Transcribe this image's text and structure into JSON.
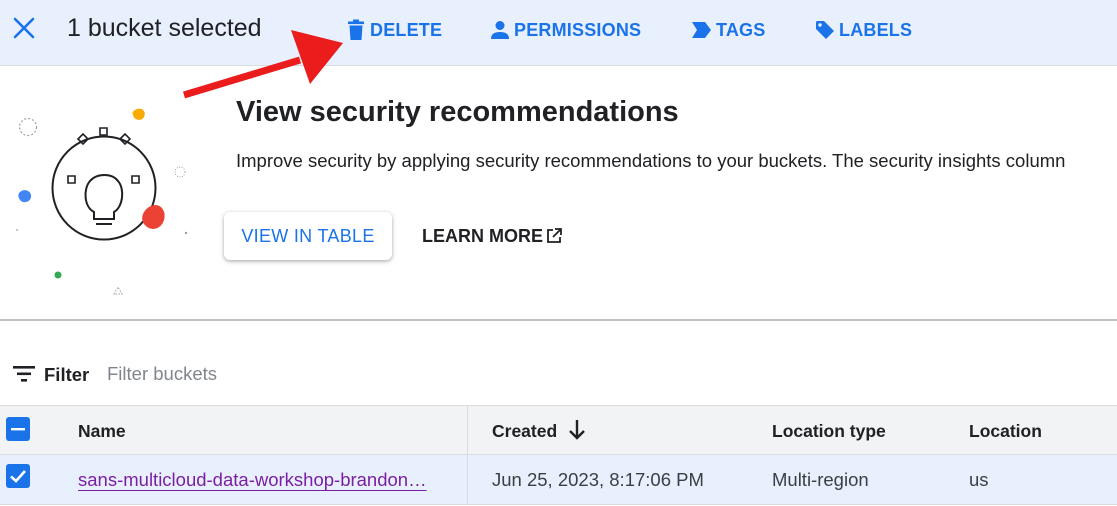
{
  "selection_bar": {
    "title": "1 bucket selected",
    "actions": [
      {
        "label": "DELETE",
        "icon": "trash-icon"
      },
      {
        "label": "PERMISSIONS",
        "icon": "person-icon"
      },
      {
        "label": "TAGS",
        "icon": "tag-arrow-icon"
      },
      {
        "label": "LABELS",
        "icon": "label-icon"
      }
    ]
  },
  "recommendations": {
    "title": "View security recommendations",
    "description": "Improve security by applying security recommendations to your buckets. The security insights column",
    "view_button": "VIEW IN TABLE",
    "learn_more": "LEARN MORE"
  },
  "filter": {
    "label": "Filter",
    "placeholder": "Filter buckets"
  },
  "table": {
    "columns": [
      "Name",
      "Created",
      "Location type",
      "Location"
    ],
    "sort_column": "Created",
    "sort_direction": "descending",
    "rows": [
      {
        "selected": true,
        "name": "sans-multicloud-data-workshop-brandon…",
        "created": "Jun 25, 2023, 8:17:06 PM",
        "location_type": "Multi-region",
        "location": "us"
      }
    ]
  },
  "colors": {
    "accent": "#1a73e8",
    "selection_bg": "#e8f0fe",
    "annotation_arrow": "#ea1c1c",
    "link_visited": "#7b1fa2"
  }
}
